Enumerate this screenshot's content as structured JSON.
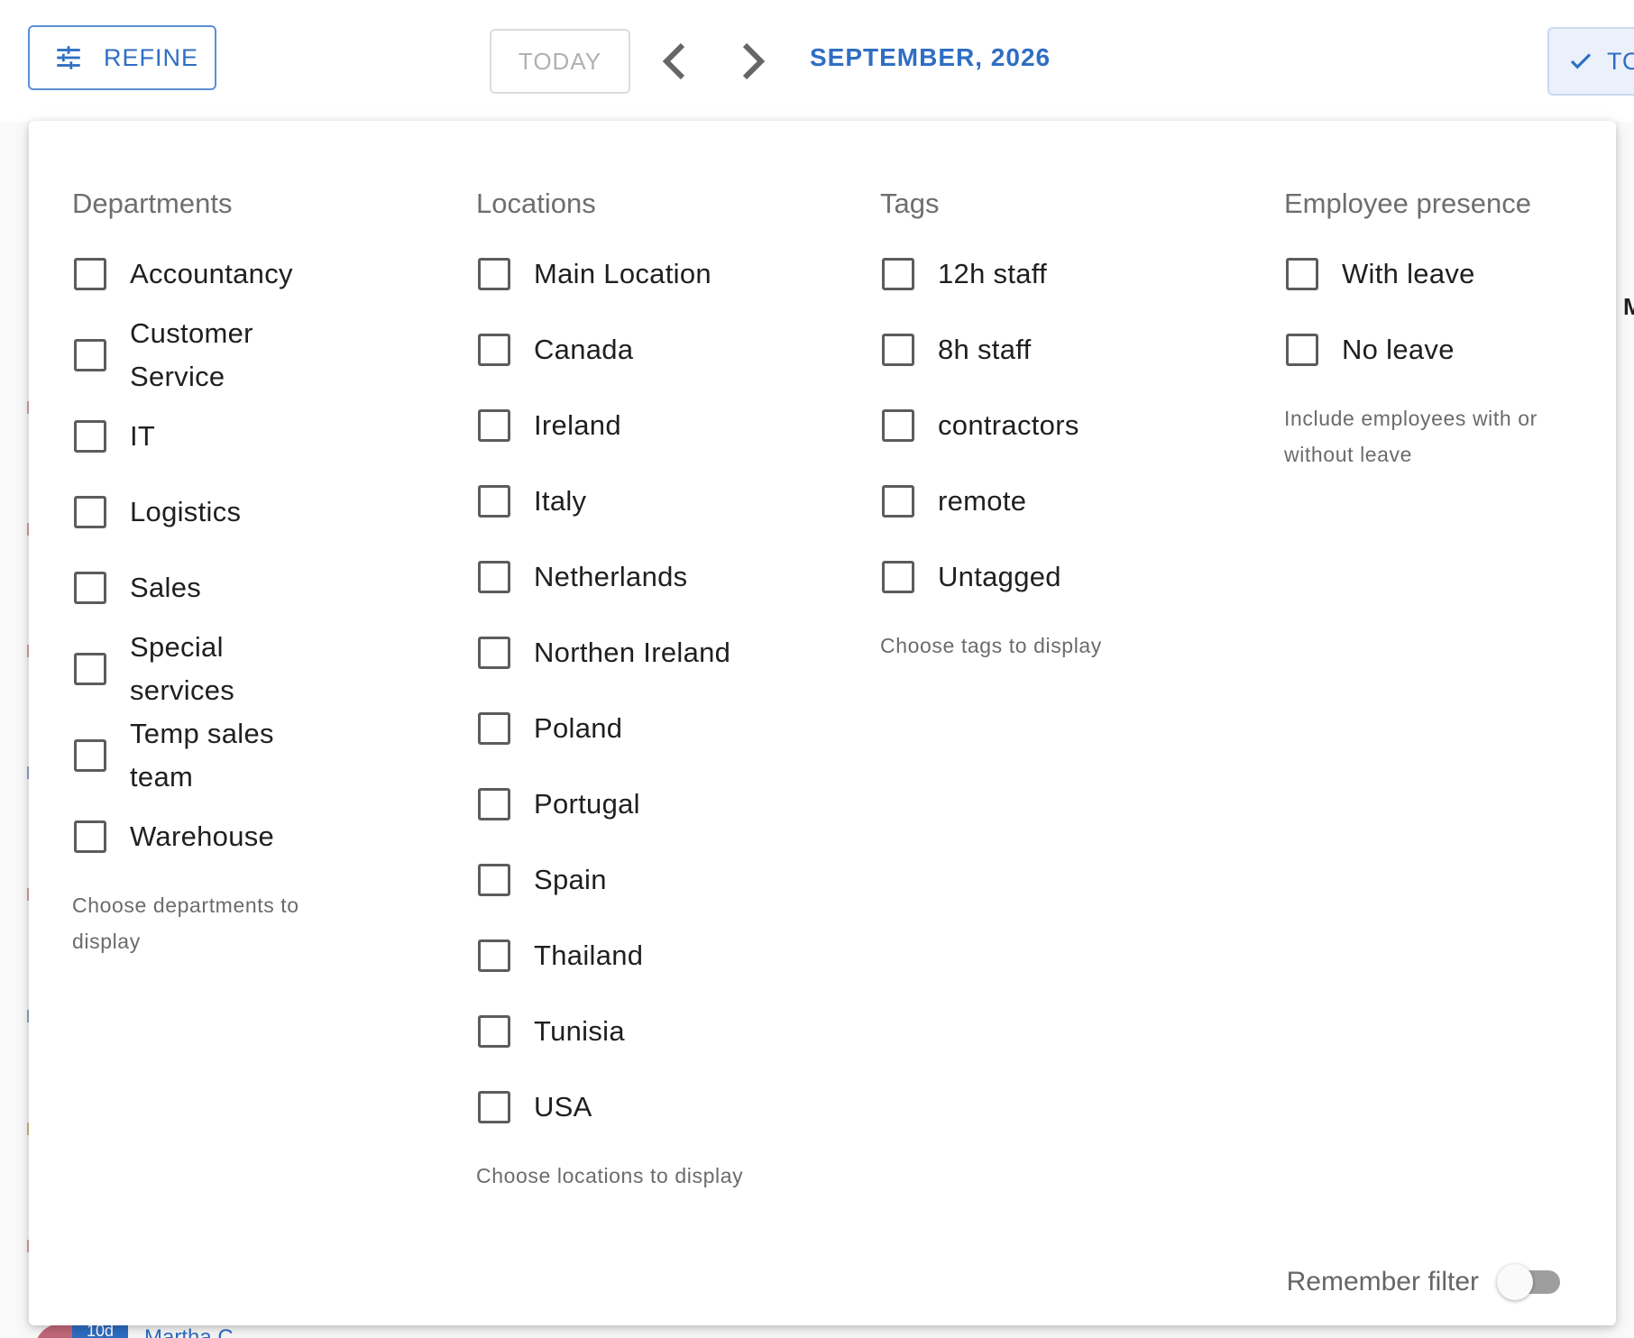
{
  "toolbar": {
    "refine_label": "REFINE",
    "today_label": "TODAY",
    "month_label": "SEPTEMBER, 2026",
    "right_button_label": "TO"
  },
  "background": {
    "right_text": "M",
    "chip_text": "10d",
    "name_text": "Martha C"
  },
  "filters": {
    "departments": {
      "title": "Departments",
      "helper": "Choose departments to display",
      "options": [
        "Accountancy",
        "Customer Service",
        "IT",
        "Logistics",
        "Sales",
        "Special services",
        "Temp sales team",
        "Warehouse"
      ]
    },
    "locations": {
      "title": "Locations",
      "helper": "Choose locations to display",
      "options": [
        "Main Location",
        "Canada",
        "Ireland",
        "Italy",
        "Netherlands",
        "Northen Ireland",
        "Poland",
        "Portugal",
        "Spain",
        "Thailand",
        "Tunisia",
        "USA"
      ]
    },
    "tags": {
      "title": "Tags",
      "helper": "Choose tags to display",
      "options": [
        "12h staff",
        "8h staff",
        "contractors",
        "remote",
        "Untagged"
      ]
    },
    "presence": {
      "title": "Employee presence",
      "helper": "Include employees with or without leave",
      "options": [
        "With leave",
        "No leave"
      ]
    }
  },
  "remember": {
    "label": "Remember filter",
    "enabled": false
  },
  "colors": {
    "accent": "#2f6ec4",
    "checkbox_border": "#5c5c5c",
    "toggle_track": "#9e9e9e"
  }
}
